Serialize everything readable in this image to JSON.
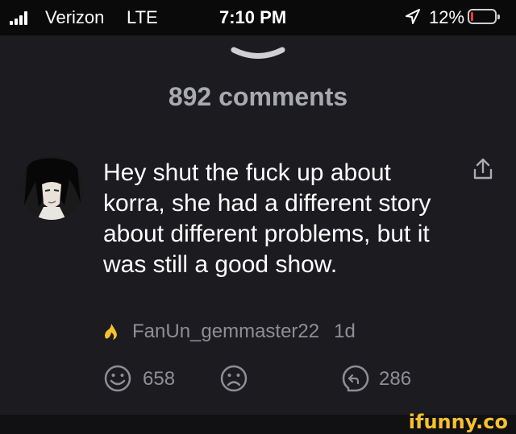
{
  "status_bar": {
    "carrier": "Verizon",
    "network": "LTE",
    "time": "7:10 PM",
    "battery_percent": "12%",
    "battery_level": 0.12,
    "battery_color": "#ff3b30"
  },
  "header": {
    "comment_count": "892 comments",
    "collapse_icon": "chevron-down-icon"
  },
  "comment": {
    "avatar_icon": "user-avatar",
    "text": "Hey shut the fuck up about korra, she had a different story about different problems, but it was still a good show.",
    "badge_icon": "flame-icon",
    "badge_color": "#f6c12b",
    "username": "FanUn_gemmaster22",
    "age": "1d",
    "share_icon": "share-icon",
    "actions": {
      "like_icon": "smile-icon",
      "like_count": "658",
      "dislike_icon": "frown-icon",
      "reply_icon": "reply-icon",
      "reply_count": "286"
    }
  },
  "brand": "ifunny.co",
  "colors": {
    "background": "#1c1c20",
    "statusbar": "#0a0a0b",
    "secondary_text": "#8e8e96",
    "brand": "#f6c12b"
  }
}
